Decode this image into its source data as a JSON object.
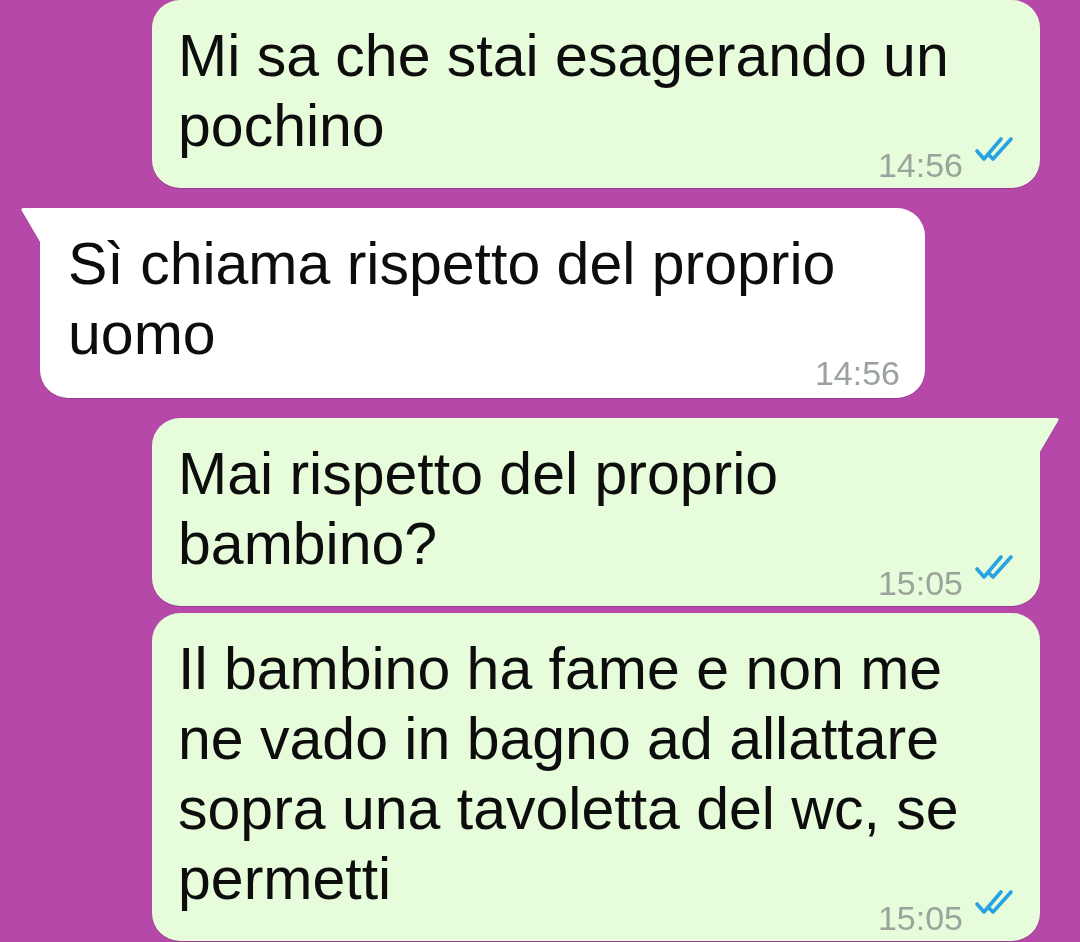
{
  "messages": [
    {
      "kind": "outgoing",
      "tail": false,
      "text": "Mi sa che stai esagerando un pochino",
      "time": "14:56",
      "read": true
    },
    {
      "kind": "incoming",
      "tail": true,
      "text": "Sì chiama rispetto del proprio uomo",
      "time": "14:56"
    },
    {
      "kind": "outgoing",
      "tail": true,
      "text": "Mai rispetto del proprio bambino?",
      "time": "15:05",
      "read": true
    },
    {
      "kind": "outgoing",
      "tail": false,
      "text": "Il bambino ha fame e non me ne vado in bagno ad allattare sopra una tavoletta del wc, se permetti",
      "time": "15:05",
      "read": true
    }
  ]
}
